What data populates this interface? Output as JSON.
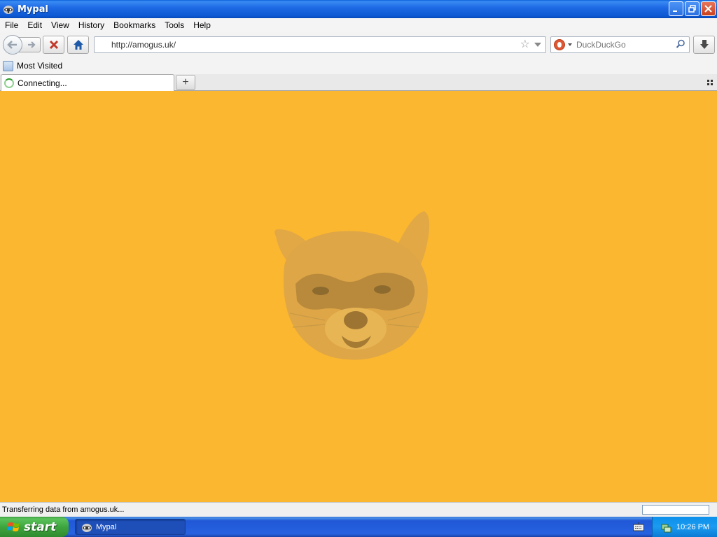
{
  "window": {
    "title": "Mypal"
  },
  "menu": {
    "items": [
      {
        "label": "File"
      },
      {
        "label": "Edit"
      },
      {
        "label": "View"
      },
      {
        "label": "History"
      },
      {
        "label": "Bookmarks"
      },
      {
        "label": "Tools"
      },
      {
        "label": "Help"
      }
    ]
  },
  "navbar": {
    "url": "http://amogus.uk/",
    "search_engine": "DuckDuckGo"
  },
  "bookmarks": {
    "items": [
      {
        "label": "Most Visited"
      }
    ]
  },
  "tabs": [
    {
      "label": "Connecting..."
    }
  ],
  "content": {
    "background": "#fbb730",
    "image": "raccoon-face"
  },
  "status": {
    "text": "Transferring data from amogus.uk..."
  },
  "taskbar": {
    "start_label": "start",
    "tasks": [
      {
        "label": "Mypal"
      }
    ],
    "clock": "10:26 PM"
  },
  "colors": {
    "titlebar": "#0c58d2",
    "page_background": "#fbb730",
    "start_button": "#3ea63e",
    "taskbar": "#2663e0"
  }
}
